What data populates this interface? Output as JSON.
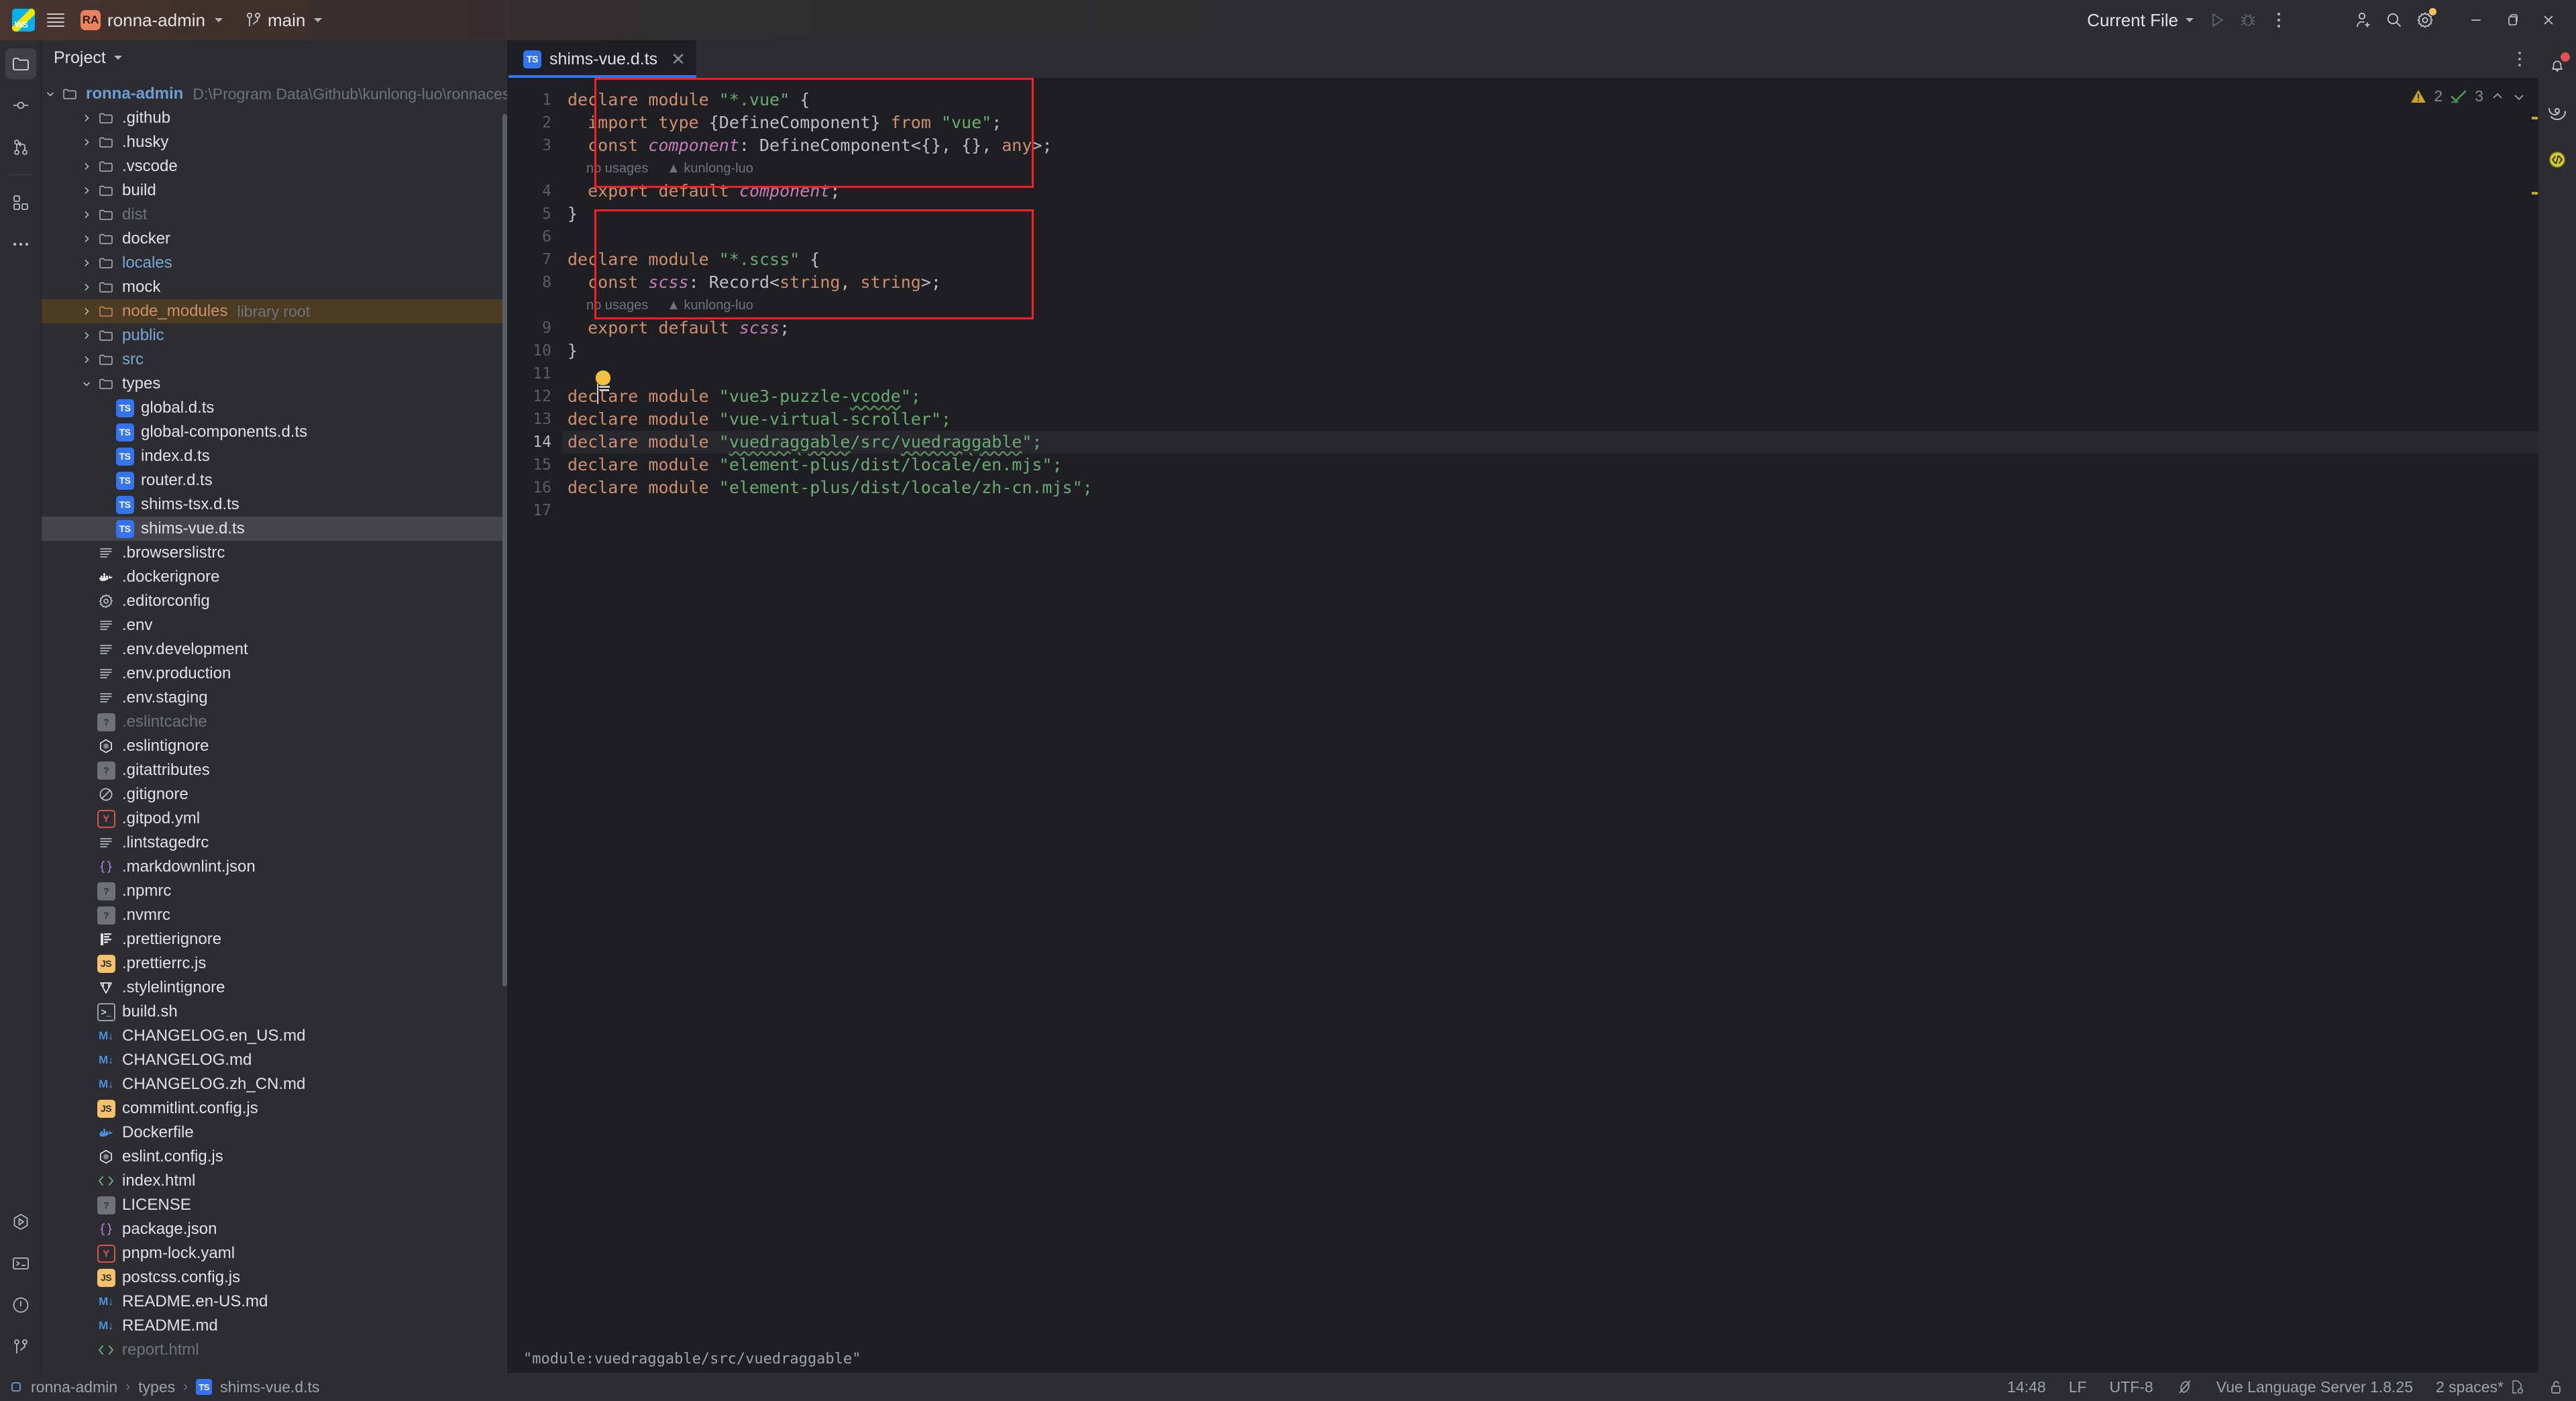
{
  "topbar": {
    "logo_name": "webstorm-logo",
    "menu_name": "main-menu-hamburger",
    "project_initials": "RA",
    "project_name": "ronna-admin",
    "branch": "main",
    "run_config": "Current File",
    "run_label": "run-button",
    "debug_label": "debug-button",
    "more_label": "more-actions",
    "account": "account-button",
    "search": "search-everywhere",
    "settings": "settings-button",
    "minimize": "–",
    "maximize": "❐",
    "close": "✕"
  },
  "stripe": {
    "items": [
      {
        "name": "project-tool-window",
        "icon": "folder-icon",
        "active": true
      },
      {
        "name": "commit-tool-window",
        "icon": "commit-icon",
        "active": false
      },
      {
        "name": "pull-requests-tool-window",
        "icon": "pull-request-icon",
        "active": false
      },
      {
        "name": "plugins-tool-window",
        "icon": "plugins-icon",
        "active": false
      },
      {
        "name": "more-tool-windows",
        "icon": "ellipsis-icon",
        "active": false
      }
    ],
    "bottom_items": [
      {
        "name": "run-tool-window",
        "icon": "run-icon"
      },
      {
        "name": "terminal-tool-window",
        "icon": "terminal-icon"
      },
      {
        "name": "problems-tool-window",
        "icon": "problems-icon"
      },
      {
        "name": "version-control-tool-window",
        "icon": "branch-icon"
      }
    ]
  },
  "panel": {
    "title": "Project",
    "root": {
      "label": "ronna-admin",
      "path": "D:\\Program Data\\Github\\kunlong-luo\\ronnaces\\ronna-admin"
    },
    "tree": [
      {
        "label": ".github",
        "indent": 1,
        "icon": "folder",
        "arrow": true,
        "style": "plain"
      },
      {
        "label": ".husky",
        "indent": 1,
        "icon": "folder",
        "arrow": true,
        "style": "plain"
      },
      {
        "label": ".vscode",
        "indent": 1,
        "icon": "folder",
        "arrow": true,
        "style": "plain"
      },
      {
        "label": "build",
        "indent": 1,
        "icon": "folder",
        "arrow": true,
        "style": "plain"
      },
      {
        "label": "dist",
        "indent": 1,
        "icon": "folder",
        "arrow": true,
        "style": "dim"
      },
      {
        "label": "docker",
        "indent": 1,
        "icon": "folder",
        "arrow": true,
        "style": "plain"
      },
      {
        "label": "locales",
        "indent": 1,
        "icon": "folder",
        "arrow": true,
        "style": "blue"
      },
      {
        "label": "mock",
        "indent": 1,
        "icon": "folder",
        "arrow": true,
        "style": "plain"
      },
      {
        "label": "node_modules",
        "indent": 1,
        "icon": "folder-orange",
        "arrow": true,
        "style": "orange",
        "suffix": "library root",
        "highlight": "folder"
      },
      {
        "label": "public",
        "indent": 1,
        "icon": "folder",
        "arrow": true,
        "style": "blue"
      },
      {
        "label": "src",
        "indent": 1,
        "icon": "folder",
        "arrow": true,
        "style": "blue"
      },
      {
        "label": "types",
        "indent": 1,
        "icon": "folder",
        "arrow": "open",
        "style": "plain"
      },
      {
        "label": "global.d.ts",
        "indent": 2,
        "icon": "ts",
        "arrow": false,
        "style": "plain"
      },
      {
        "label": "global-components.d.ts",
        "indent": 2,
        "icon": "ts",
        "arrow": false,
        "style": "plain"
      },
      {
        "label": "index.d.ts",
        "indent": 2,
        "icon": "ts",
        "arrow": false,
        "style": "plain"
      },
      {
        "label": "router.d.ts",
        "indent": 2,
        "icon": "ts",
        "arrow": false,
        "style": "plain"
      },
      {
        "label": "shims-tsx.d.ts",
        "indent": 2,
        "icon": "ts",
        "arrow": false,
        "style": "plain"
      },
      {
        "label": "shims-vue.d.ts",
        "indent": 2,
        "icon": "ts",
        "arrow": false,
        "style": "plain",
        "highlight": "file"
      },
      {
        "label": ".browserslistrc",
        "indent": 1,
        "icon": "text",
        "arrow": false,
        "style": "plain"
      },
      {
        "label": ".dockerignore",
        "indent": 1,
        "icon": "docker",
        "arrow": false,
        "style": "plain"
      },
      {
        "label": ".editorconfig",
        "indent": 1,
        "icon": "gear",
        "arrow": false,
        "style": "plain"
      },
      {
        "label": ".env",
        "indent": 1,
        "icon": "text",
        "arrow": false,
        "style": "plain"
      },
      {
        "label": ".env.development",
        "indent": 1,
        "icon": "text",
        "arrow": false,
        "style": "plain"
      },
      {
        "label": ".env.production",
        "indent": 1,
        "icon": "text",
        "arrow": false,
        "style": "plain"
      },
      {
        "label": ".env.staging",
        "indent": 1,
        "icon": "text",
        "arrow": false,
        "style": "plain"
      },
      {
        "label": ".eslintcache",
        "indent": 1,
        "icon": "unknown",
        "arrow": false,
        "style": "dim"
      },
      {
        "label": ".eslintignore",
        "indent": 1,
        "icon": "eslint",
        "arrow": false,
        "style": "plain"
      },
      {
        "label": ".gitattributes",
        "indent": 1,
        "icon": "unknown",
        "arrow": false,
        "style": "plain"
      },
      {
        "label": ".gitignore",
        "indent": 1,
        "icon": "ignore",
        "arrow": false,
        "style": "plain"
      },
      {
        "label": ".gitpod.yml",
        "indent": 1,
        "icon": "yaml",
        "arrow": false,
        "style": "plain"
      },
      {
        "label": ".lintstagedrc",
        "indent": 1,
        "icon": "text",
        "arrow": false,
        "style": "plain"
      },
      {
        "label": ".markdownlint.json",
        "indent": 1,
        "icon": "json",
        "arrow": false,
        "style": "plain"
      },
      {
        "label": ".npmrc",
        "indent": 1,
        "icon": "unknown",
        "arrow": false,
        "style": "plain"
      },
      {
        "label": ".nvmrc",
        "indent": 1,
        "icon": "unknown",
        "arrow": false,
        "style": "plain"
      },
      {
        "label": ".prettierignore",
        "indent": 1,
        "icon": "prettier",
        "arrow": false,
        "style": "plain"
      },
      {
        "label": ".prettierrc.js",
        "indent": 1,
        "icon": "js",
        "arrow": false,
        "style": "plain"
      },
      {
        "label": ".stylelintignore",
        "indent": 1,
        "icon": "stylelint",
        "arrow": false,
        "style": "plain"
      },
      {
        "label": "build.sh",
        "indent": 1,
        "icon": "shell",
        "arrow": false,
        "style": "plain"
      },
      {
        "label": "CHANGELOG.en_US.md",
        "indent": 1,
        "icon": "md",
        "arrow": false,
        "style": "plain"
      },
      {
        "label": "CHANGELOG.md",
        "indent": 1,
        "icon": "md",
        "arrow": false,
        "style": "plain"
      },
      {
        "label": "CHANGELOG.zh_CN.md",
        "indent": 1,
        "icon": "md",
        "arrow": false,
        "style": "plain"
      },
      {
        "label": "commitlint.config.js",
        "indent": 1,
        "icon": "js",
        "arrow": false,
        "style": "plain"
      },
      {
        "label": "Dockerfile",
        "indent": 1,
        "icon": "docker-blue",
        "arrow": false,
        "style": "plain"
      },
      {
        "label": "eslint.config.js",
        "indent": 1,
        "icon": "eslint",
        "arrow": false,
        "style": "plain"
      },
      {
        "label": "index.html",
        "indent": 1,
        "icon": "html",
        "arrow": false,
        "style": "plain"
      },
      {
        "label": "LICENSE",
        "indent": 1,
        "icon": "unknown",
        "arrow": false,
        "style": "plain"
      },
      {
        "label": "package.json",
        "indent": 1,
        "icon": "json",
        "arrow": false,
        "style": "plain"
      },
      {
        "label": "pnpm-lock.yaml",
        "indent": 1,
        "icon": "yaml",
        "arrow": false,
        "style": "plain"
      },
      {
        "label": "postcss.config.js",
        "indent": 1,
        "icon": "js",
        "arrow": false,
        "style": "plain"
      },
      {
        "label": "README.en-US.md",
        "indent": 1,
        "icon": "md",
        "arrow": false,
        "style": "plain"
      },
      {
        "label": "README.md",
        "indent": 1,
        "icon": "md",
        "arrow": false,
        "style": "plain"
      },
      {
        "label": "report.html",
        "indent": 1,
        "icon": "html",
        "arrow": false,
        "style": "dim"
      }
    ]
  },
  "editor": {
    "tab": {
      "label": "shims-vue.d.ts",
      "icon": "ts-file-icon",
      "close": "✕"
    },
    "inspections": {
      "warning_count": "2",
      "ok_count": "3",
      "warn_icon": "warning-triangle-icon",
      "ok_icon": "checkmark-icon"
    },
    "lines": [
      {
        "n": "1",
        "tokens": [
          {
            "t": "declare module ",
            "c": "kw"
          },
          {
            "t": "\"*.vue\"",
            "c": "str"
          },
          {
            "t": " {",
            "c": "plain"
          }
        ]
      },
      {
        "n": "2",
        "tokens": [
          {
            "t": "  ",
            "c": "plain"
          },
          {
            "t": "import type ",
            "c": "kw"
          },
          {
            "t": "{DefineComponent} ",
            "c": "plain"
          },
          {
            "t": "from ",
            "c": "kw"
          },
          {
            "t": "\"vue\"",
            "c": "str"
          },
          {
            "t": ";",
            "c": "plain"
          }
        ]
      },
      {
        "n": "3",
        "tokens": [
          {
            "t": "  ",
            "c": "plain"
          },
          {
            "t": "const ",
            "c": "kw"
          },
          {
            "t": "component",
            "c": "ident"
          },
          {
            "t": ": DefineComponent<{}, {}, ",
            "c": "plain"
          },
          {
            "t": "any",
            "c": "kw"
          },
          {
            "t": ">;",
            "c": "plain"
          }
        ]
      },
      {
        "n": "",
        "hint": "no usages     ▲ kunlong-luo"
      },
      {
        "n": "4",
        "tokens": [
          {
            "t": "  ",
            "c": "plain"
          },
          {
            "t": "export default ",
            "c": "kw"
          },
          {
            "t": "component",
            "c": "ident"
          },
          {
            "t": ";",
            "c": "plain"
          }
        ]
      },
      {
        "n": "5",
        "tokens": [
          {
            "t": "}",
            "c": "plain"
          }
        ]
      },
      {
        "n": "6",
        "tokens": []
      },
      {
        "n": "7",
        "tokens": [
          {
            "t": "declare module ",
            "c": "kw"
          },
          {
            "t": "\"*.scss\"",
            "c": "str"
          },
          {
            "t": " {",
            "c": "plain"
          }
        ]
      },
      {
        "n": "8",
        "tokens": [
          {
            "t": "  ",
            "c": "plain"
          },
          {
            "t": "const ",
            "c": "kw"
          },
          {
            "t": "scss",
            "c": "ident"
          },
          {
            "t": ": Record<",
            "c": "plain"
          },
          {
            "t": "string",
            "c": "kw"
          },
          {
            "t": ", ",
            "c": "plain"
          },
          {
            "t": "string",
            "c": "kw"
          },
          {
            "t": ">;",
            "c": "plain"
          }
        ]
      },
      {
        "n": "",
        "hint": "no usages     ▲ kunlong-luo"
      },
      {
        "n": "9",
        "tokens": [
          {
            "t": "  ",
            "c": "plain"
          },
          {
            "t": "export default ",
            "c": "kw"
          },
          {
            "t": "scss",
            "c": "ident"
          },
          {
            "t": ";",
            "c": "plain"
          }
        ]
      },
      {
        "n": "10",
        "tokens": [
          {
            "t": "}",
            "c": "plain"
          }
        ]
      },
      {
        "n": "11",
        "tokens": []
      },
      {
        "n": "12",
        "tokens": [
          {
            "t": "declare module ",
            "c": "kw"
          },
          {
            "t": "\"vue3-puzzle-",
            "c": "str"
          },
          {
            "t": "vcode",
            "c": "str-squig"
          },
          {
            "t": "\";",
            "c": "str"
          }
        ]
      },
      {
        "n": "13",
        "tokens": [
          {
            "t": "declare module ",
            "c": "kw"
          },
          {
            "t": "\"vue-virtual-scroller\";",
            "c": "str"
          }
        ]
      },
      {
        "n": "14",
        "tokens": [
          {
            "t": "declare module ",
            "c": "kw"
          },
          {
            "t": "\"",
            "c": "str"
          },
          {
            "t": "vuedraggable",
            "c": "str-squig"
          },
          {
            "t": "/src/",
            "c": "str"
          },
          {
            "t": "vuedraggable",
            "c": "str-squig"
          },
          {
            "t": "\";",
            "c": "str"
          }
        ],
        "current": true
      },
      {
        "n": "15",
        "tokens": [
          {
            "t": "declare module ",
            "c": "kw"
          },
          {
            "t": "\"element-plus/dist/locale/en.mjs\";",
            "c": "str"
          }
        ]
      },
      {
        "n": "16",
        "tokens": [
          {
            "t": "declare module ",
            "c": "kw"
          },
          {
            "t": "\"element-plus/dist/locale/zh-cn.mjs\";",
            "c": "str"
          }
        ]
      },
      {
        "n": "17",
        "tokens": []
      }
    ],
    "hint_text": "\"module:vuedraggable/src/vuedraggable\"",
    "lightbulb": "intention-bulb-icon"
  },
  "right_stripe": {
    "items": [
      {
        "name": "notifications-button",
        "icon": "bell-icon",
        "dot": true
      },
      {
        "name": "ai-assistant-button",
        "icon": "spiral-icon",
        "dot": false
      },
      {
        "name": "code-with-me-button",
        "icon": "code-circle-icon",
        "dot": false
      }
    ]
  },
  "status": {
    "breadcrumb": [
      "ronna-admin",
      "types",
      "shims-vue.d.ts"
    ],
    "breadcrumb_sep": "›",
    "position": "14:48",
    "line_sep": "LF",
    "encoding": "UTF-8",
    "readonly_icon": "no-read-only-icon",
    "language_server": "Vue Language Server 1.8.25",
    "indent": "2 spaces*",
    "indent_icon": "indent-config-icon",
    "lock_icon": "unlocked-icon"
  },
  "colors": {
    "accent": "#3574f0",
    "error_box": "#ff1d1d",
    "warning": "#c9a227",
    "keyword": "#cf8e6d",
    "string": "#6aab73",
    "identifier": "#c77dbb"
  }
}
